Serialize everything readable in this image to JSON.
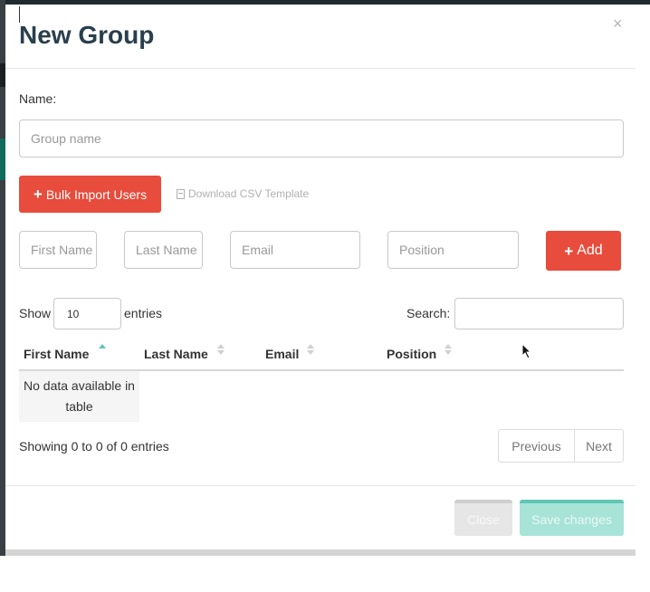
{
  "modal": {
    "title": "New Group",
    "close_glyph": "×"
  },
  "form": {
    "name_label": "Name:",
    "group_name_placeholder": "Group name",
    "bulk_import_label": "Bulk Import Users",
    "download_csv_label": "Download CSV Template",
    "first_name_placeholder": "First Name",
    "last_name_placeholder": "Last Name",
    "email_placeholder": "Email",
    "position_placeholder": "Position",
    "add_label": "Add"
  },
  "table": {
    "show_label": "Show",
    "entries_value": "10",
    "entries_label": "entries",
    "search_label": "Search:",
    "search_value": "",
    "columns": [
      "First Name",
      "Last Name",
      "Email",
      "Position"
    ],
    "empty_message": "No data available in table",
    "info": "Showing 0 to 0 of 0 entries",
    "pagination": {
      "previous": "Previous",
      "next": "Next"
    }
  },
  "footer": {
    "close_label": "Close",
    "save_label": "Save changes"
  },
  "colors": {
    "accent_red": "#e74c3c",
    "accent_teal": "#5fc7b6",
    "title": "#2a3f4d"
  },
  "icons": [
    "plus-icon",
    "file-icon",
    "sort-icon",
    "close-icon",
    "mouse-cursor-icon"
  ]
}
